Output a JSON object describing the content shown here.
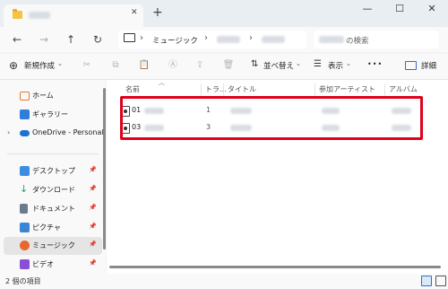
{
  "window": {
    "new_tab": "+",
    "minimize": "—",
    "maximize": "☐",
    "close": "✕"
  },
  "address": {
    "sep": "›",
    "crumb_music": "ミュージック",
    "search_suffix": "の検索"
  },
  "toolbar": {
    "new_label": "新規作成",
    "sort_label": "並べ替え",
    "view_label": "表示",
    "more_label": "•••",
    "details_label": "詳細"
  },
  "sidebar": {
    "items": [
      {
        "label": "ホーム",
        "icon": "home-icon",
        "color": "#e8772e"
      },
      {
        "label": "ギャラリー",
        "icon": "gallery-icon",
        "color": "#2f7ed8"
      },
      {
        "label": "OneDrive - Personal",
        "icon": "cloud-icon",
        "color": "#1e73d2"
      },
      {
        "label": "デスクトップ",
        "icon": "desktop-icon",
        "color": "#3b8ee3"
      },
      {
        "label": "ダウンロード",
        "icon": "download-icon",
        "color": "#2a9d6b"
      },
      {
        "label": "ドキュメント",
        "icon": "document-icon",
        "color": "#6b7b8c"
      },
      {
        "label": "ピクチャ",
        "icon": "pictures-icon",
        "color": "#3a86d6"
      },
      {
        "label": "ミュージック",
        "icon": "music-icon",
        "color": "#e8672e"
      },
      {
        "label": "ビデオ",
        "icon": "video-icon",
        "color": "#8a4fd6"
      }
    ]
  },
  "columns": {
    "name": "名前",
    "track": "トラ...",
    "title": "タイトル",
    "artist": "参加アーティスト",
    "album": "アルバム"
  },
  "files": [
    {
      "number": "01",
      "track": "1"
    },
    {
      "number": "03",
      "track": "3"
    }
  ],
  "status": {
    "count": "2 個の項目"
  },
  "colors": {
    "highlight": "#e0001b",
    "selected_nav": "#e5e5e5"
  }
}
